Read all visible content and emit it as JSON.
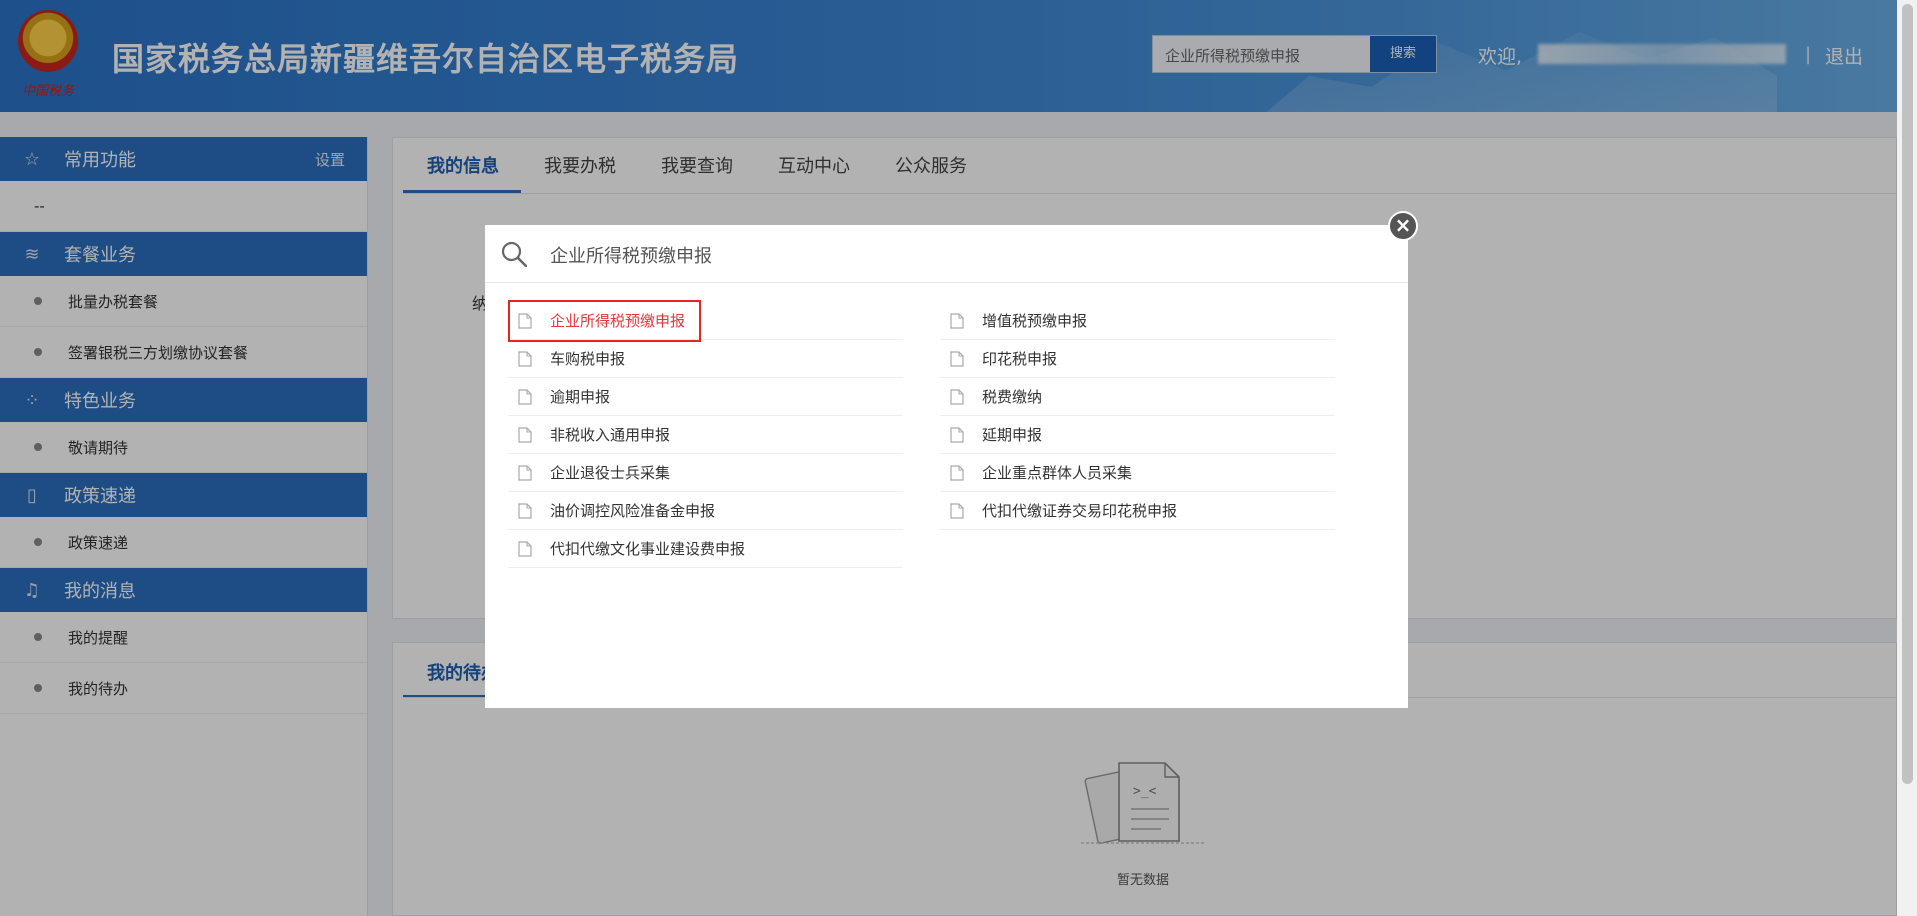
{
  "header": {
    "site_title": "国家税务总局新疆维吾尔自治区电子税务局",
    "emblem_script": "中国税务",
    "search_value": "企业所得税预缴申报",
    "search_button": "搜索",
    "welcome": "欢迎,",
    "separator": "|",
    "logout": "退出"
  },
  "sidebar": {
    "sections": [
      {
        "icon": "star-icon",
        "label": "常用功能",
        "action": "设置",
        "items": [
          "--"
        ]
      },
      {
        "icon": "layers-icon",
        "label": "套餐业务",
        "items": [
          "批量办税套餐",
          "签署银税三方划缴协议套餐"
        ]
      },
      {
        "icon": "grid-icon",
        "label": "特色业务",
        "items": [
          "敬请期待"
        ]
      },
      {
        "icon": "document-icon",
        "label": "政策速递",
        "items": [
          "政策速递"
        ]
      },
      {
        "icon": "bell-icon",
        "label": "我的消息",
        "items": [
          "我的提醒",
          "我的待办"
        ]
      }
    ]
  },
  "main": {
    "tabs": [
      "我的信息",
      "我要办税",
      "我要查询",
      "互动中心",
      "公众服务"
    ],
    "bg_label": "纳",
    "todo_tab": "我的待办",
    "empty_text": "暂无数据"
  },
  "modal": {
    "search_text": "企业所得税预缴申报",
    "close": "×",
    "left_items": [
      "企业所得税预缴申报",
      "车购税申报",
      "逾期申报",
      "非税收入通用申报",
      "企业退役士兵采集",
      "油价调控风险准备金申报",
      "代扣代缴文化事业建设费申报"
    ],
    "right_items": [
      "增值税预缴申报",
      "印花税申报",
      "税费缴纳",
      "延期申报",
      "企业重点群体人员采集",
      "代扣代缴证券交易印花税申报"
    ]
  },
  "colors": {
    "header_blue": "#2b74c8",
    "sidebar_blue": "#2c6fc0",
    "highlight_red": "#e4393c",
    "search_button": "#1c5fb8"
  }
}
